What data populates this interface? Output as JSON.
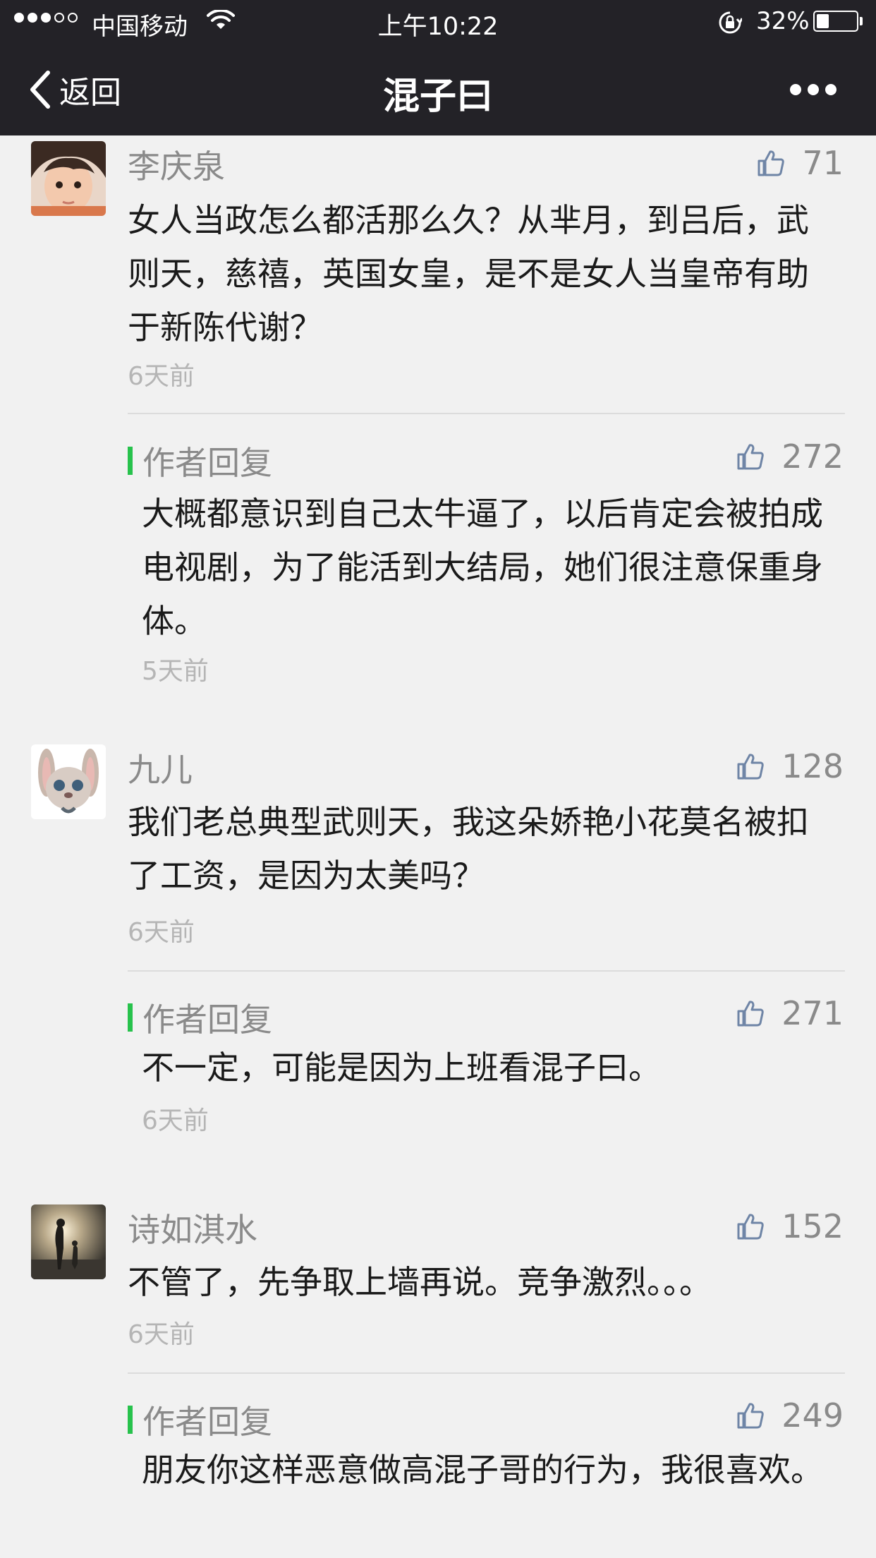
{
  "status_bar": {
    "carrier": "中国移动",
    "time": "上午10:22",
    "battery_percent": "32%",
    "battery_level": 0.32,
    "signal_strength": 3,
    "icons": [
      "signal-dots-icon",
      "wifi-icon",
      "rotation-lock-icon",
      "battery-icon"
    ]
  },
  "nav": {
    "back_label": "返回",
    "title": "混子曰",
    "icons": [
      "chevron-left-icon",
      "more-icon"
    ]
  },
  "comments": [
    {
      "name": "李庆泉",
      "likes": "71",
      "text": "女人当政怎么都活那么久？从芈月，到吕后，武则天，慈禧，英国女皇，是不是女人当皇帝有助于新陈代谢？",
      "time": "6天前",
      "reply": {
        "label": "作者回复",
        "likes": "272",
        "text": "大概都意识到自己太牛逼了，以后肯定会被拍成电视剧，为了能活到大结局，她们很注意保重身体。",
        "time": "5天前"
      }
    },
    {
      "name": "九儿",
      "likes": "128",
      "text": "我们老总典型武则天，我这朵娇艳小花莫名被扣了工资，是因为太美吗？",
      "time": "6天前",
      "reply": {
        "label": "作者回复",
        "likes": "271",
        "text": "不一定，可能是因为上班看混子曰。",
        "time": "6天前"
      }
    },
    {
      "name": "诗如淇水",
      "likes": "152",
      "text": "不管了，先争取上墙再说。竞争激烈。。。",
      "time": "6天前",
      "reply": {
        "label": "作者回复",
        "likes": "249",
        "text": "朋友你这样恶意做高混子哥的行为，我很喜欢。",
        "time": ""
      }
    }
  ],
  "colors": {
    "top_bar": "#232227",
    "background": "#f1f1f1",
    "reply_accent": "#27c24c",
    "like_icon": "#6f85a6"
  }
}
